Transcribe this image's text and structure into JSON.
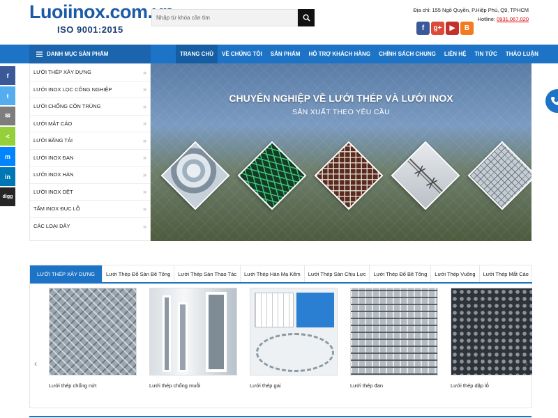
{
  "header": {
    "logo_text": "Luoiinox.com.vn",
    "logo_sub": "ISO 9001:2015",
    "search_placeholder": "Nhập từ khóa cần tìm",
    "address": "Địa chỉ: 155 Ngô Quyền, P.Hiệp Phú, Q9, TPHCM",
    "hotline_label": "Hotline:",
    "hotline": "0931.067.020",
    "social": [
      "facebook-icon",
      "google-plus-icon",
      "youtube-icon",
      "blogger-icon"
    ]
  },
  "nav": {
    "category_heading": "DANH MỤC SẢN PHẨM",
    "items": [
      {
        "label": "TRANG CHỦ"
      },
      {
        "label": "VỀ CHÚNG TÔI"
      },
      {
        "label": "SẢN PHẨM"
      },
      {
        "label": "HỖ TRỢ KHÁCH HÀNG"
      },
      {
        "label": "CHÍNH SÁCH CHUNG"
      },
      {
        "label": "LIÊN HỆ"
      },
      {
        "label": "TIN TỨC"
      },
      {
        "label": "THẢO LUẬN"
      }
    ]
  },
  "share": {
    "items": [
      {
        "label": "f",
        "color": "#3b5998",
        "icon": "facebook-icon"
      },
      {
        "label": "t",
        "color": "#55acee",
        "icon": "twitter-icon"
      },
      {
        "label": "✉",
        "color": "#7d7d7d",
        "icon": "email-icon"
      },
      {
        "label": "<",
        "color": "#95d03a",
        "icon": "share-icon"
      },
      {
        "label": "m",
        "color": "#0084ff",
        "icon": "messenger-icon"
      },
      {
        "label": "in",
        "color": "#0077b5",
        "icon": "linkedin-icon"
      },
      {
        "label": "digg",
        "color": "#262626",
        "icon": "digg-icon"
      }
    ]
  },
  "categories": [
    {
      "label": "LƯỚI THÉP XÂY DỰNG"
    },
    {
      "label": "LƯỚI INOX LỌC CÔNG NGHIỆP"
    },
    {
      "label": "LƯỚI CHỐNG CÔN TRÙNG"
    },
    {
      "label": "LƯỚI MẮT CÁO"
    },
    {
      "label": "LƯỚI BĂNG TẢI"
    },
    {
      "label": "LƯỚI INOX ĐAN"
    },
    {
      "label": "LƯỚI INOX HÀN"
    },
    {
      "label": "LƯỚI INOX DỆT"
    },
    {
      "label": "TẤM INOX ĐỤC LỖ"
    },
    {
      "label": "CÁC LOẠI DÂY"
    }
  ],
  "banner": {
    "headline": "CHUYÊN NGHIỆP VỀ LƯỚI THÉP VÀ LƯỚI INOX",
    "subline": "SẢN XUẤT THEO YÊU CẦU"
  },
  "products_section": {
    "tabs": [
      {
        "label": "LƯỚI THÉP XÂY DỰNG"
      },
      {
        "label": "Lưới Thép Đổ Sàn Bê Tông"
      },
      {
        "label": "Lưới Thép Sàn Thao Tác"
      },
      {
        "label": "Lưới Thép Hàn Mạ Kẽm"
      },
      {
        "label": "Lưới Thép Sàn Chịu Lực"
      },
      {
        "label": "Lưới Thép Đổ Bê Tông"
      },
      {
        "label": "Lưới Thép Vuông"
      },
      {
        "label": "Lưới Thép Mắt Cáo"
      }
    ],
    "products": [
      {
        "caption": "Lưới thép chống nứt"
      },
      {
        "caption": "Lưới thép chống muỗi"
      },
      {
        "caption": "Lưới thép gai"
      },
      {
        "caption": "Lưới thép đan"
      },
      {
        "caption": "Lưới thép dập lỗ"
      }
    ]
  },
  "colors": {
    "primary": "#1d74c6",
    "logo": "#1a5aa8",
    "hotline": "#dd0000"
  }
}
